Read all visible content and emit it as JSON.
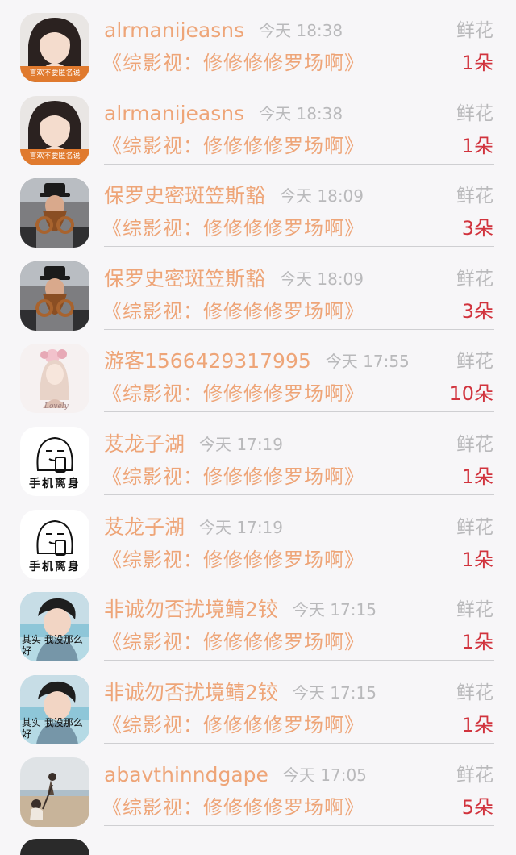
{
  "rows": [
    {
      "name": "alrmanijeasns",
      "time": "今天 18:38",
      "gift": "鲜花",
      "work": "《综影视：修修修修罗场啊》",
      "count": "1朵",
      "avatar": "girl-portrait-avatar",
      "avatar_caption": "喜欢不要匿名说"
    },
    {
      "name": "alrmanijeasns",
      "time": "今天 18:38",
      "gift": "鲜花",
      "work": "《综影视：修修修修罗场啊》",
      "count": "1朵",
      "avatar": "girl-portrait-avatar",
      "avatar_caption": "喜欢不要匿名说"
    },
    {
      "name": "保罗史密斑笠斯豁",
      "time": "今天 18:09",
      "gift": "鲜花",
      "work": "《综影视：修修修修罗场啊》",
      "count": "3朵",
      "avatar": "bearded-man-avatar",
      "avatar_caption": ""
    },
    {
      "name": "保罗史密斑笠斯豁",
      "time": "今天 18:09",
      "gift": "鲜花",
      "work": "《综影视：修修修修罗场啊》",
      "count": "3朵",
      "avatar": "bearded-man-avatar",
      "avatar_caption": ""
    },
    {
      "name": "游客1566429317995",
      "time": "今天 17:55",
      "gift": "鲜花",
      "work": "《综影视：修修修修罗场啊》",
      "count": "10朵",
      "avatar": "illustration-girl-avatar",
      "avatar_caption": ""
    },
    {
      "name": "芨龙子湖",
      "time": "今天 17:19",
      "gift": "鲜花",
      "work": "《综影视：修修修修罗场啊》",
      "count": "1朵",
      "avatar": "meme-phone-avatar",
      "avatar_caption": "手机离身"
    },
    {
      "name": "芨龙子湖",
      "time": "今天 17:19",
      "gift": "鲜花",
      "work": "《综影视：修修修修罗场啊》",
      "count": "1朵",
      "avatar": "meme-phone-avatar",
      "avatar_caption": "手机离身"
    },
    {
      "name": "非诚勿否扰境鲭2铰",
      "time": "今天 17:15",
      "gift": "鲜花",
      "work": "《综影视：修修修修罗场啊》",
      "count": "1朵",
      "avatar": "boy-portrait-avatar",
      "avatar_caption": "其实 我没那么好"
    },
    {
      "name": "非诚勿否扰境鲭2铰",
      "time": "今天 17:15",
      "gift": "鲜花",
      "work": "《综影视：修修修修罗场啊》",
      "count": "1朵",
      "avatar": "boy-portrait-avatar",
      "avatar_caption": "其实 我没那么好"
    },
    {
      "name": "abavthinndgape",
      "time": "今天 17:05",
      "gift": "鲜花",
      "work": "《综影视：修修修修罗场啊》",
      "count": "5朵",
      "avatar": "beach-couple-avatar",
      "avatar_caption": ""
    }
  ]
}
